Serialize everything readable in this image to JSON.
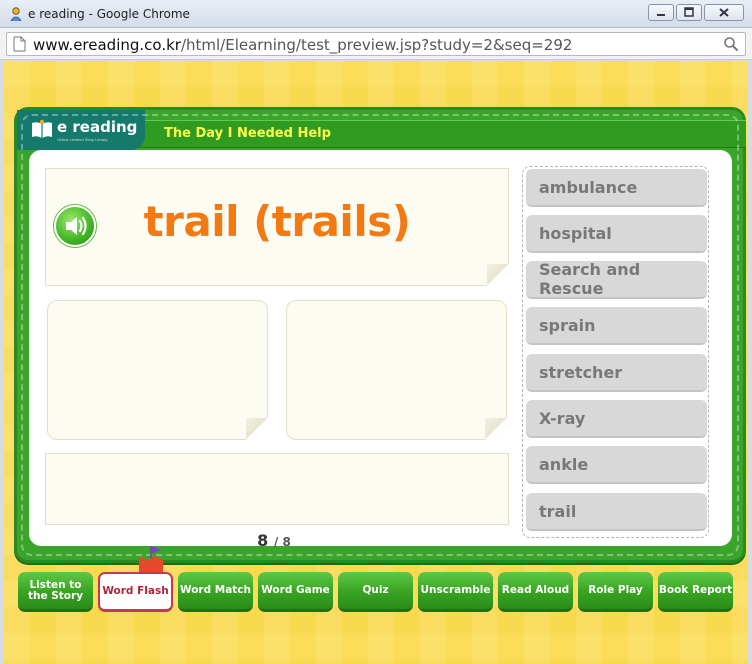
{
  "window": {
    "title": "e reading - Google Chrome"
  },
  "address": {
    "host": "www.ereading.co.kr",
    "path": "/html/Elearning/test_preview.jsp?study=2&seq=292"
  },
  "header": {
    "logo": "e reading",
    "logo_sub": "Online Leveled Story Library",
    "story_title": "The Day I Needed Help"
  },
  "card": {
    "word": "trail (trails)"
  },
  "pagination": {
    "current": "8",
    "total": "/ 8"
  },
  "word_list": [
    "ambulance",
    "hospital",
    "Search and Rescue",
    "sprain",
    "stretcher",
    "X-ray",
    "ankle",
    "trail"
  ],
  "nav": [
    {
      "label": "Listen to the Story",
      "active": false
    },
    {
      "label": "Word Flash",
      "active": true
    },
    {
      "label": "Word Match",
      "active": false
    },
    {
      "label": "Word Game",
      "active": false
    },
    {
      "label": "Quiz",
      "active": false
    },
    {
      "label": "Unscramble",
      "active": false
    },
    {
      "label": "Read Aloud",
      "active": false
    },
    {
      "label": "Role Play",
      "active": false
    },
    {
      "label": "Book Report",
      "active": false
    }
  ],
  "colors": {
    "accent": "#f37a12",
    "board": "#3aa52a",
    "background": "#f9d94e",
    "title_text": "#ffff4a"
  }
}
